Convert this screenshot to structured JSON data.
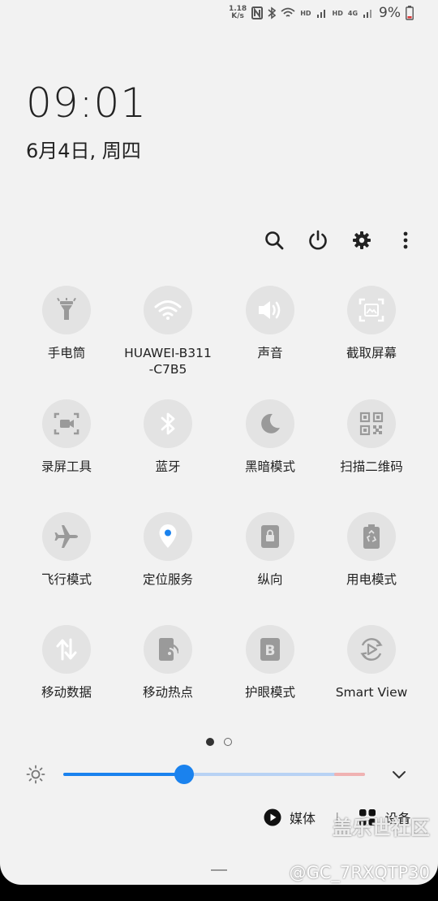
{
  "status_bar": {
    "speed_top": "1.18",
    "speed_unit": "K/s",
    "hd1": "HD",
    "hd2": "HD",
    "net1": "4G",
    "net2": "4G",
    "battery": "9%"
  },
  "clock": {
    "time": "09:01",
    "date": "6月4日, 周四"
  },
  "tiles": [
    {
      "label": "手电筒",
      "on": false,
      "icon": "flashlight-icon"
    },
    {
      "label": "HUAWEI-B311-C7B5",
      "on": true,
      "icon": "wifi-icon"
    },
    {
      "label": "声音",
      "on": true,
      "icon": "sound-icon"
    },
    {
      "label": "截取屏幕",
      "on": true,
      "icon": "screenshot-icon"
    },
    {
      "label": "录屏工具",
      "on": false,
      "icon": "screen-record-icon"
    },
    {
      "label": "蓝牙",
      "on": true,
      "icon": "bluetooth-icon"
    },
    {
      "label": "黑暗模式",
      "on": false,
      "icon": "moon-icon"
    },
    {
      "label": "扫描二维码",
      "on": false,
      "icon": "qr-code-icon"
    },
    {
      "label": "飞行模式",
      "on": false,
      "icon": "airplane-icon"
    },
    {
      "label": "定位服务",
      "on": true,
      "icon": "location-icon"
    },
    {
      "label": "纵向",
      "on": false,
      "icon": "portrait-lock-icon"
    },
    {
      "label": "用电模式",
      "on": false,
      "icon": "battery-saver-icon"
    },
    {
      "label": "移动数据",
      "on": true,
      "icon": "mobile-data-icon"
    },
    {
      "label": "移动热点",
      "on": false,
      "icon": "hotspot-icon"
    },
    {
      "label": "护眼模式",
      "on": false,
      "icon": "eye-comfort-icon"
    },
    {
      "label": "Smart View",
      "on": false,
      "icon": "smart-view-icon"
    }
  ],
  "brightness": {
    "level": 0.4
  },
  "media": {
    "media_label": "媒体",
    "separator": "|",
    "devices_label": "设备"
  },
  "watermark": {
    "line1": "盖乐世社区",
    "line2": "@GC_7RXQTP30"
  },
  "colors": {
    "accent": "#1a82ee",
    "panel": "#f2f2f2",
    "inactive": "#e3e3e3"
  }
}
